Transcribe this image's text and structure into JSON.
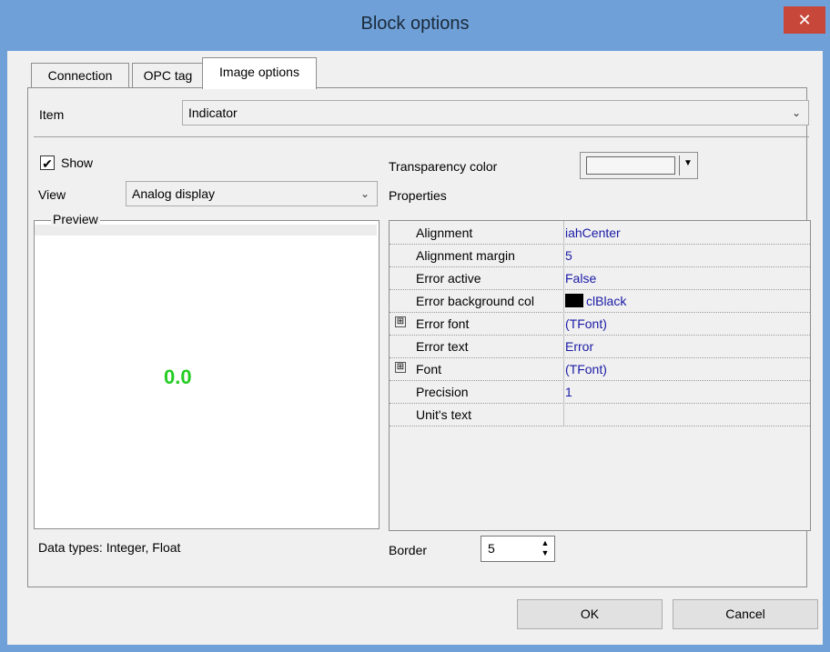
{
  "window": {
    "title": "Block options",
    "close_glyph": "✕"
  },
  "tabs": [
    {
      "label": "Connection"
    },
    {
      "label": "OPC tag"
    },
    {
      "label": "Image options"
    }
  ],
  "item": {
    "label": "Item",
    "value": "Indicator"
  },
  "show": {
    "label": "Show",
    "checked": true,
    "check_glyph": "✔"
  },
  "view": {
    "label": "View",
    "value": "Analog display"
  },
  "preview": {
    "legend": "Preview",
    "value": "0.0"
  },
  "data_types": "Data types: Integer, Float",
  "transparency": {
    "label": "Transparency color"
  },
  "properties": {
    "label": "Properties",
    "rows": [
      {
        "name": "Alignment",
        "value": "iahCenter",
        "expandable": false
      },
      {
        "name": "Alignment margin",
        "value": "5",
        "expandable": false
      },
      {
        "name": "Error active",
        "value": "False",
        "expandable": false
      },
      {
        "name": "Error background col",
        "value": "clBlack",
        "expandable": false,
        "swatch": "#000000"
      },
      {
        "name": "Error font",
        "value": "(TFont)",
        "expandable": true
      },
      {
        "name": "Error text",
        "value": "Error",
        "expandable": false
      },
      {
        "name": "Font",
        "value": "(TFont)",
        "expandable": true
      },
      {
        "name": "Precision",
        "value": "1",
        "expandable": false
      },
      {
        "name": "Unit's text",
        "value": "",
        "expandable": false
      }
    ]
  },
  "border": {
    "label": "Border",
    "value": "5"
  },
  "buttons": {
    "ok": "OK",
    "cancel": "Cancel"
  },
  "icons": {
    "expand": "⊞",
    "dropdown": "⌄",
    "spin_up": "▲",
    "spin_down": "▼"
  },
  "colors": {
    "titlebar": "#6fa0d8",
    "close": "#c7483b",
    "value_green": "#22cc22",
    "prop_value": "#1a1aa6"
  }
}
